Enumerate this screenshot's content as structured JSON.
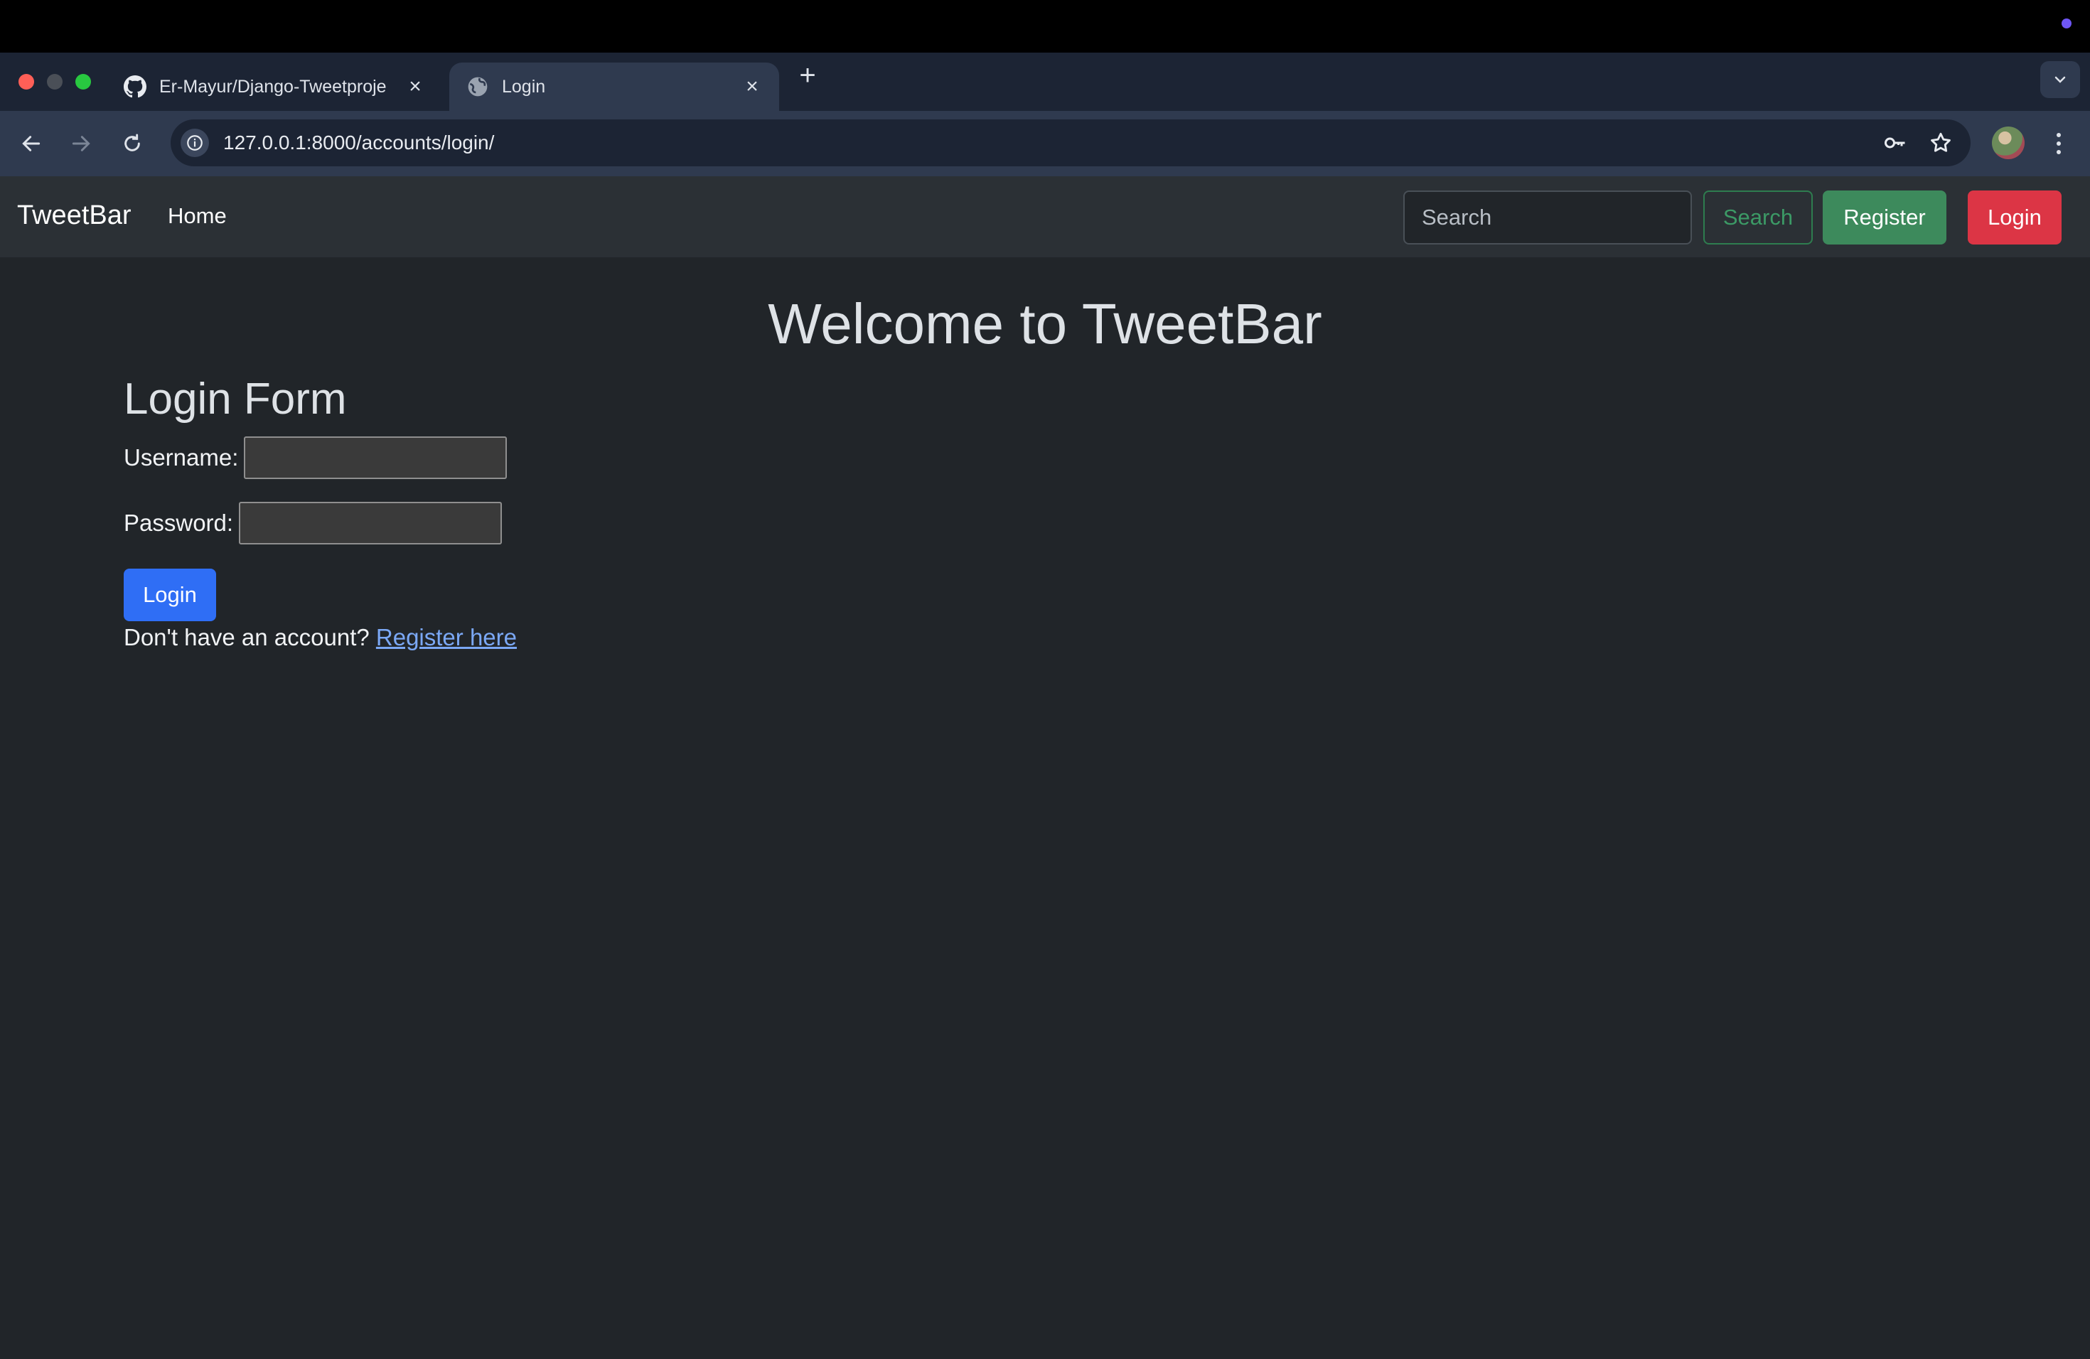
{
  "browser": {
    "tabs": [
      {
        "title": "Er-Mayur/Django-Tweetproje",
        "favicon": "github-icon",
        "active": false
      },
      {
        "title": "Login",
        "favicon": "globe-icon",
        "active": true
      }
    ],
    "new_tab_label": "+",
    "url": "127.0.0.1:8000/accounts/login/"
  },
  "navbar": {
    "brand": "TweetBar",
    "home_label": "Home",
    "search_placeholder": "Search",
    "search_button": "Search",
    "register_button": "Register",
    "login_button": "Login"
  },
  "main": {
    "welcome": "Welcome to TweetBar",
    "form_title": "Login Form",
    "username_label": "Username:",
    "password_label": "Password:",
    "submit_label": "Login",
    "signup_prompt": "Don't have an account?",
    "signup_link": "Register here"
  },
  "colors": {
    "page_bg": "#212529",
    "navbar_bg": "#2b3035",
    "register_green": "#3d8a5c",
    "login_red": "#dc3545",
    "submit_blue": "#2f6ef5",
    "link_blue": "#7ba8f5"
  }
}
